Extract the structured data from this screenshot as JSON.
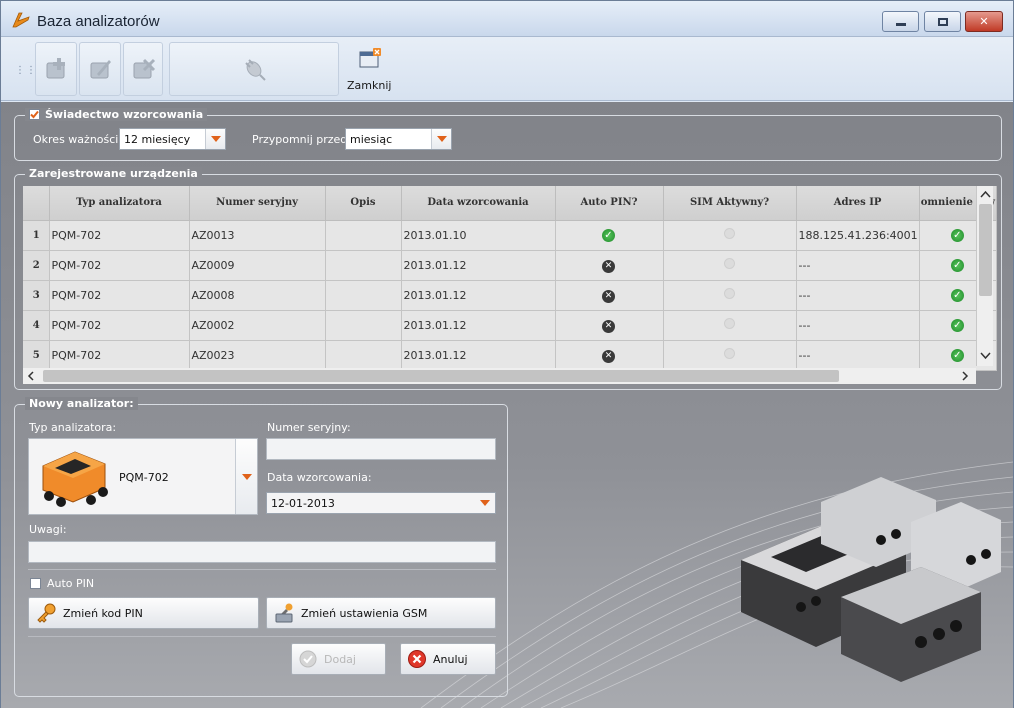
{
  "window": {
    "title": "Baza analizatorów"
  },
  "toolbar": {
    "close_label": "Zamknij"
  },
  "certificate": {
    "title": "Świadectwo wzorcowania",
    "checked": true,
    "validity_label": "Okres ważności:",
    "validity_value": "12 miesięcy",
    "remind_label": "Przypomnij przed:",
    "remind_value": "miesiąc"
  },
  "devices": {
    "title": "Zarejestrowane urządzenia",
    "columns": [
      "Typ analizatora",
      "Numer seryjny",
      "Opis",
      "Data wzorcowania",
      "Auto PIN?",
      "SIM Aktywny?",
      "Adres IP",
      "omnienie o w"
    ],
    "rows": [
      {
        "num": "1",
        "type": "PQM-702",
        "serial": "AZ0013",
        "desc": "",
        "date": "2013.01.10",
        "auto_pin": "ok",
        "sim": "off",
        "ip": "188.125.41.236:4001",
        "remind": "ok"
      },
      {
        "num": "2",
        "type": "PQM-702",
        "serial": "AZ0009",
        "desc": "",
        "date": "2013.01.12",
        "auto_pin": "no",
        "sim": "off",
        "ip": "---",
        "remind": "ok"
      },
      {
        "num": "3",
        "type": "PQM-702",
        "serial": "AZ0008",
        "desc": "",
        "date": "2013.01.12",
        "auto_pin": "no",
        "sim": "off",
        "ip": "---",
        "remind": "ok"
      },
      {
        "num": "4",
        "type": "PQM-702",
        "serial": "AZ0002",
        "desc": "",
        "date": "2013.01.12",
        "auto_pin": "no",
        "sim": "off",
        "ip": "---",
        "remind": "ok"
      },
      {
        "num": "5",
        "type": "PQM-702",
        "serial": "AZ0023",
        "desc": "",
        "date": "2013.01.12",
        "auto_pin": "no",
        "sim": "off",
        "ip": "---",
        "remind": "ok"
      }
    ]
  },
  "new_analyzer": {
    "title": "Nowy analizator:",
    "type_label": "Typ analizatora:",
    "type_value": "PQM-702",
    "serial_label": "Numer seryjny:",
    "serial_value": "",
    "date_label": "Data wzorcowania:",
    "date_value": "12-01-2013",
    "notes_label": "Uwagi:",
    "notes_value": "",
    "auto_pin_label": "Auto PIN",
    "auto_pin_checked": false,
    "change_pin_label": "Zmień kod PIN",
    "change_gsm_label": "Zmień ustawienia GSM",
    "add_label": "Dodaj",
    "cancel_label": "Anuluj"
  }
}
